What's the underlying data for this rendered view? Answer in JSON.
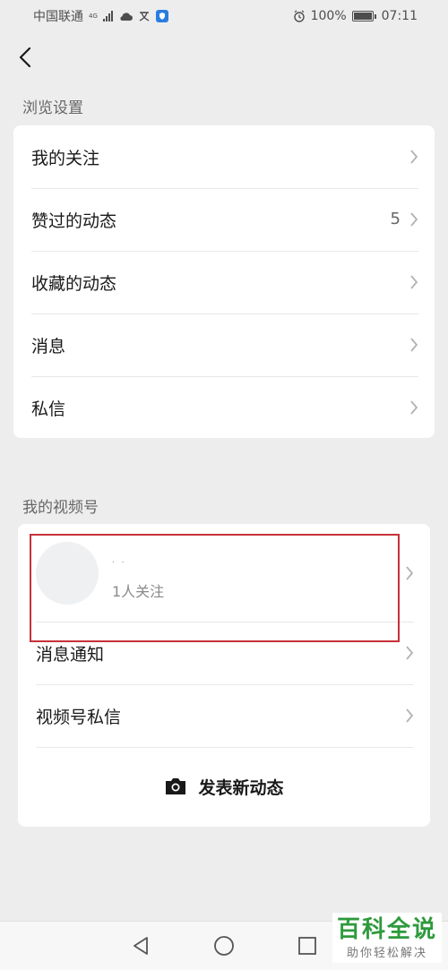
{
  "status_bar": {
    "carrier": "中国联通",
    "network": "4G",
    "battery": "100%",
    "time": "07:11"
  },
  "browse_settings": {
    "title": "浏览设置",
    "items": [
      {
        "label": "我的关注",
        "count": ""
      },
      {
        "label": "赞过的动态",
        "count": "5"
      },
      {
        "label": "收藏的动态",
        "count": ""
      },
      {
        "label": "消息",
        "count": ""
      },
      {
        "label": "私信",
        "count": ""
      }
    ]
  },
  "my_channel": {
    "title": "我的视频号",
    "channel_name": "· ·",
    "followers": "1人关注",
    "items": [
      {
        "label": "消息通知"
      },
      {
        "label": "视频号私信"
      }
    ],
    "post_label": "发表新动态"
  },
  "watermark": {
    "main": "百科全说",
    "sub": "助你轻松解决"
  },
  "colors": {
    "background": "#ededed",
    "card": "#ffffff",
    "highlight_border": "#c8313a",
    "watermark_green": "#2e9a3c"
  }
}
